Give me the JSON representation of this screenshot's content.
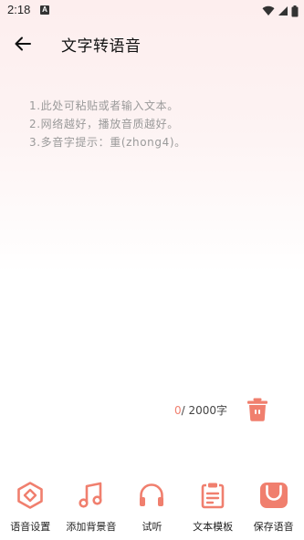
{
  "status_bar": {
    "time": "2:18",
    "notification_icon": "A"
  },
  "app_bar": {
    "title": "文字转语音"
  },
  "editor": {
    "placeholder": "1.此处可粘贴或者输入文本。\n2.网络越好，播放音质越好。\n3.多音字提示：重(zhong4)。",
    "value": ""
  },
  "counter": {
    "current": "0",
    "max_text": "/ 2000字"
  },
  "bottom_bar": {
    "items": [
      {
        "label": "语音设置",
        "icon": "voice-settings-icon"
      },
      {
        "label": "添加背景音",
        "icon": "music-note-icon"
      },
      {
        "label": "试听",
        "icon": "headphones-icon"
      },
      {
        "label": "文本模板",
        "icon": "text-template-icon"
      },
      {
        "label": "保存语音",
        "icon": "save-voice-icon"
      }
    ]
  },
  "colors": {
    "accent": "#f07f6e"
  }
}
